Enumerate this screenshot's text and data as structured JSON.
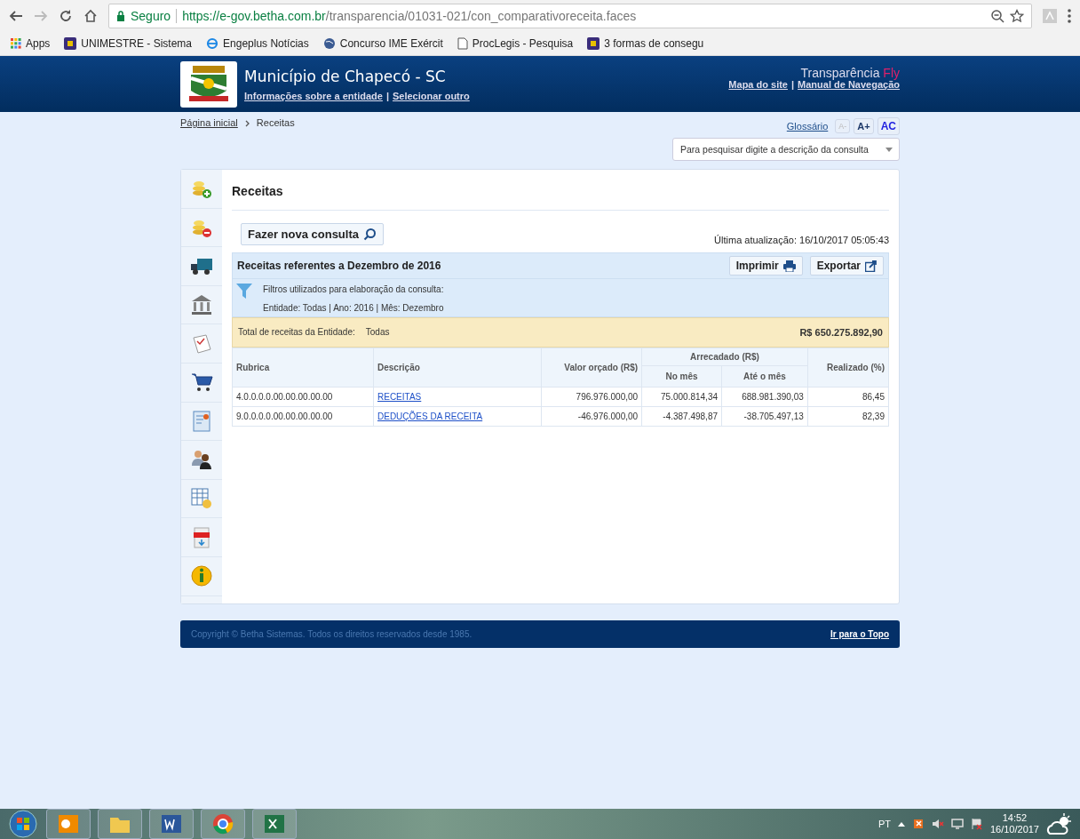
{
  "browser": {
    "secure_label": "Seguro",
    "url_host": "https://e-gov.betha.com.br",
    "url_path": "/transparencia/01031-021/con_comparativoreceita.faces"
  },
  "bookmarks": [
    {
      "kind": "apps",
      "label": "Apps"
    },
    {
      "kind": "site",
      "label": "UNIMESTRE - Sistema"
    },
    {
      "kind": "ie",
      "label": "Engeplus Notícias"
    },
    {
      "kind": "globe",
      "label": "Concurso IME Exércit"
    },
    {
      "kind": "page",
      "label": "ProcLegis - Pesquisa"
    },
    {
      "kind": "site",
      "label": "3 formas de consegu"
    }
  ],
  "header": {
    "title": "Município de Chapecó - SC",
    "entity_links": [
      "Informações sobre a entidade",
      "Selecionar outro"
    ],
    "link_separator": "|",
    "brand": "Transparência",
    "brand_accent": "Fly",
    "nav_links": [
      "Mapa do site",
      "Manual de Navegação"
    ]
  },
  "breadcrumb": [
    "Página inicial",
    "Receitas"
  ],
  "tools": {
    "glossary": "Glossário",
    "font_buttons": [
      {
        "label": "A-",
        "disabled": true
      },
      {
        "label": "A+",
        "disabled": false
      },
      {
        "label": "AC",
        "disabled": false
      }
    ],
    "search_placeholder": "Para pesquisar digite a descrição da consulta"
  },
  "panel": {
    "title": "Receitas",
    "new_query": "Fazer nova consulta",
    "last_update": "Última atualização: 16/10/2017 05:05:43",
    "report_title": "Receitas referentes a Dezembro de 2016",
    "actions": [
      "Imprimir",
      "Exportar"
    ],
    "filters_heading": "Filtros utilizados para elaboração da consulta:",
    "filters": "Entidade: Todas | Ano: 2016 | Mês: Dezembro",
    "total_label": "Total de receitas da Entidade:",
    "total_entity": "Todas",
    "total_value": "R$ 650.275.892,90"
  },
  "table": {
    "columns": [
      "Rubrica",
      "Descrição",
      "Valor orçado (R$)",
      "Realizado (%)"
    ],
    "group": "Arrecadado (R$)",
    "subcolumns": [
      "No mês",
      "Até o mês"
    ],
    "rows": [
      {
        "rubrica": "4.0.0.0.0.00.00.00.00.00",
        "descricao": "RECEITAS",
        "orcado": "796.976.000,00",
        "mes": "75.000.814,34",
        "ate": "688.981.390,03",
        "realizado": "86,45"
      },
      {
        "rubrica": "9.0.0.0.0.00.00.00.00.00",
        "descricao": "DEDUÇÕES DA RECEITA",
        "orcado": "-46.976.000,00",
        "mes": "-4.387.498,87",
        "ate": "-38.705.497,13",
        "realizado": "82,39"
      }
    ]
  },
  "footer": {
    "copyright": "Copyright © Betha Sistemas. Todos os direitos reservados desde 1985.",
    "top_link": "Ir para o Topo"
  },
  "taskbar": {
    "language": "PT",
    "time": "14:52",
    "date": "16/10/2017"
  }
}
